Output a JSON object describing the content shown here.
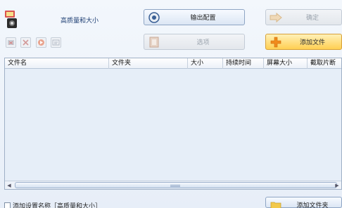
{
  "profile": {
    "name": "高质量和大小",
    "icon": "video-profile-icon"
  },
  "buttons": {
    "output_config": "输出配置",
    "confirm": "确定",
    "options": "选项",
    "add_file": "添加文件",
    "add_folder": "添加文件夹"
  },
  "toolbar": {
    "icons": [
      "remove-icon",
      "clear-icon",
      "play-icon",
      "info-icon"
    ]
  },
  "table": {
    "columns": [
      "文件名",
      "文件夹",
      "大小",
      "持续时间",
      "屏幕大小",
      "截取片断"
    ],
    "rows": []
  },
  "bottom": {
    "checkbox_label": "添加设置名称［高质量和大小］",
    "checkbox_checked": false
  },
  "colors": {
    "accent_orange": "#ffcf52",
    "border_blue": "#8ea5c4"
  }
}
